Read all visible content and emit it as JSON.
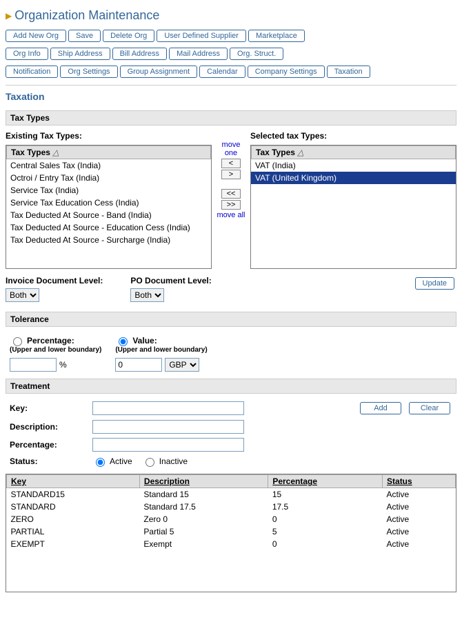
{
  "page_title": "Organization Maintenance",
  "buttons_row1": [
    "Add New Org",
    "Save",
    "Delete Org",
    "User Defined Supplier",
    "Marketplace"
  ],
  "buttons_row2": [
    "Org Info",
    "Ship Address",
    "Bill Address",
    "Mail Address",
    "Org. Struct."
  ],
  "buttons_row3": [
    "Notification",
    "Org Settings",
    "Group Assignment",
    "Calendar",
    "Company Settings",
    "Taxation"
  ],
  "section_title": "Taxation",
  "tax_types": {
    "header": "Tax Types",
    "existing_label": "Existing Tax Types:",
    "selected_label": "Selected tax Types:",
    "column_header": "Tax Types",
    "existing": [
      "Central Sales Tax (India)",
      "Octroi / Entry Tax (India)",
      "Service Tax (India)",
      "Service Tax Education Cess (India)",
      "Tax Deducted At Source - Band (India)",
      "Tax Deducted At Source - Education Cess (India)",
      "Tax Deducted At Source - Surcharge (India)"
    ],
    "selected": [
      {
        "label": "VAT (India)",
        "sel": false
      },
      {
        "label": "VAT (United Kingdom)",
        "sel": true
      }
    ],
    "mover": {
      "move_one": "move one",
      "lt": "<",
      "gt": ">",
      "ltlt": "<<",
      "gtgt": ">>",
      "move_all": "move all"
    }
  },
  "doc_levels": {
    "invoice_label": "Invoice Document Level:",
    "po_label": "PO Document Level:",
    "options": [
      "Both"
    ],
    "invoice_value": "Both",
    "po_value": "Both",
    "update": "Update"
  },
  "tolerance": {
    "header": "Tolerance",
    "percentage_label": "Percentage:",
    "value_label": "Value:",
    "boundary": "(Upper and lower boundary)",
    "pct_suffix": "%",
    "value_input": "0",
    "currency_options": [
      "GBP"
    ],
    "currency_value": "GBP",
    "selected": "value"
  },
  "treatment": {
    "header": "Treatment",
    "key_label": "Key:",
    "desc_label": "Description:",
    "pct_label": "Percentage:",
    "status_label": "Status:",
    "active_label": "Active",
    "inactive_label": "Inactive",
    "status_value": "active",
    "add": "Add",
    "clear": "Clear",
    "columns": [
      "Key",
      "Description",
      "Percentage",
      "Status"
    ],
    "rows": [
      {
        "key": "STANDARD15",
        "desc": "Standard 15",
        "pct": "15",
        "status": "Active"
      },
      {
        "key": "STANDARD",
        "desc": "Standard 17.5",
        "pct": "17.5",
        "status": "Active"
      },
      {
        "key": "ZERO",
        "desc": "Zero 0",
        "pct": "0",
        "status": "Active"
      },
      {
        "key": "PARTIAL",
        "desc": "Partial 5",
        "pct": "5",
        "status": "Active"
      },
      {
        "key": "EXEMPT",
        "desc": "Exempt",
        "pct": "0",
        "status": "Active"
      }
    ]
  }
}
